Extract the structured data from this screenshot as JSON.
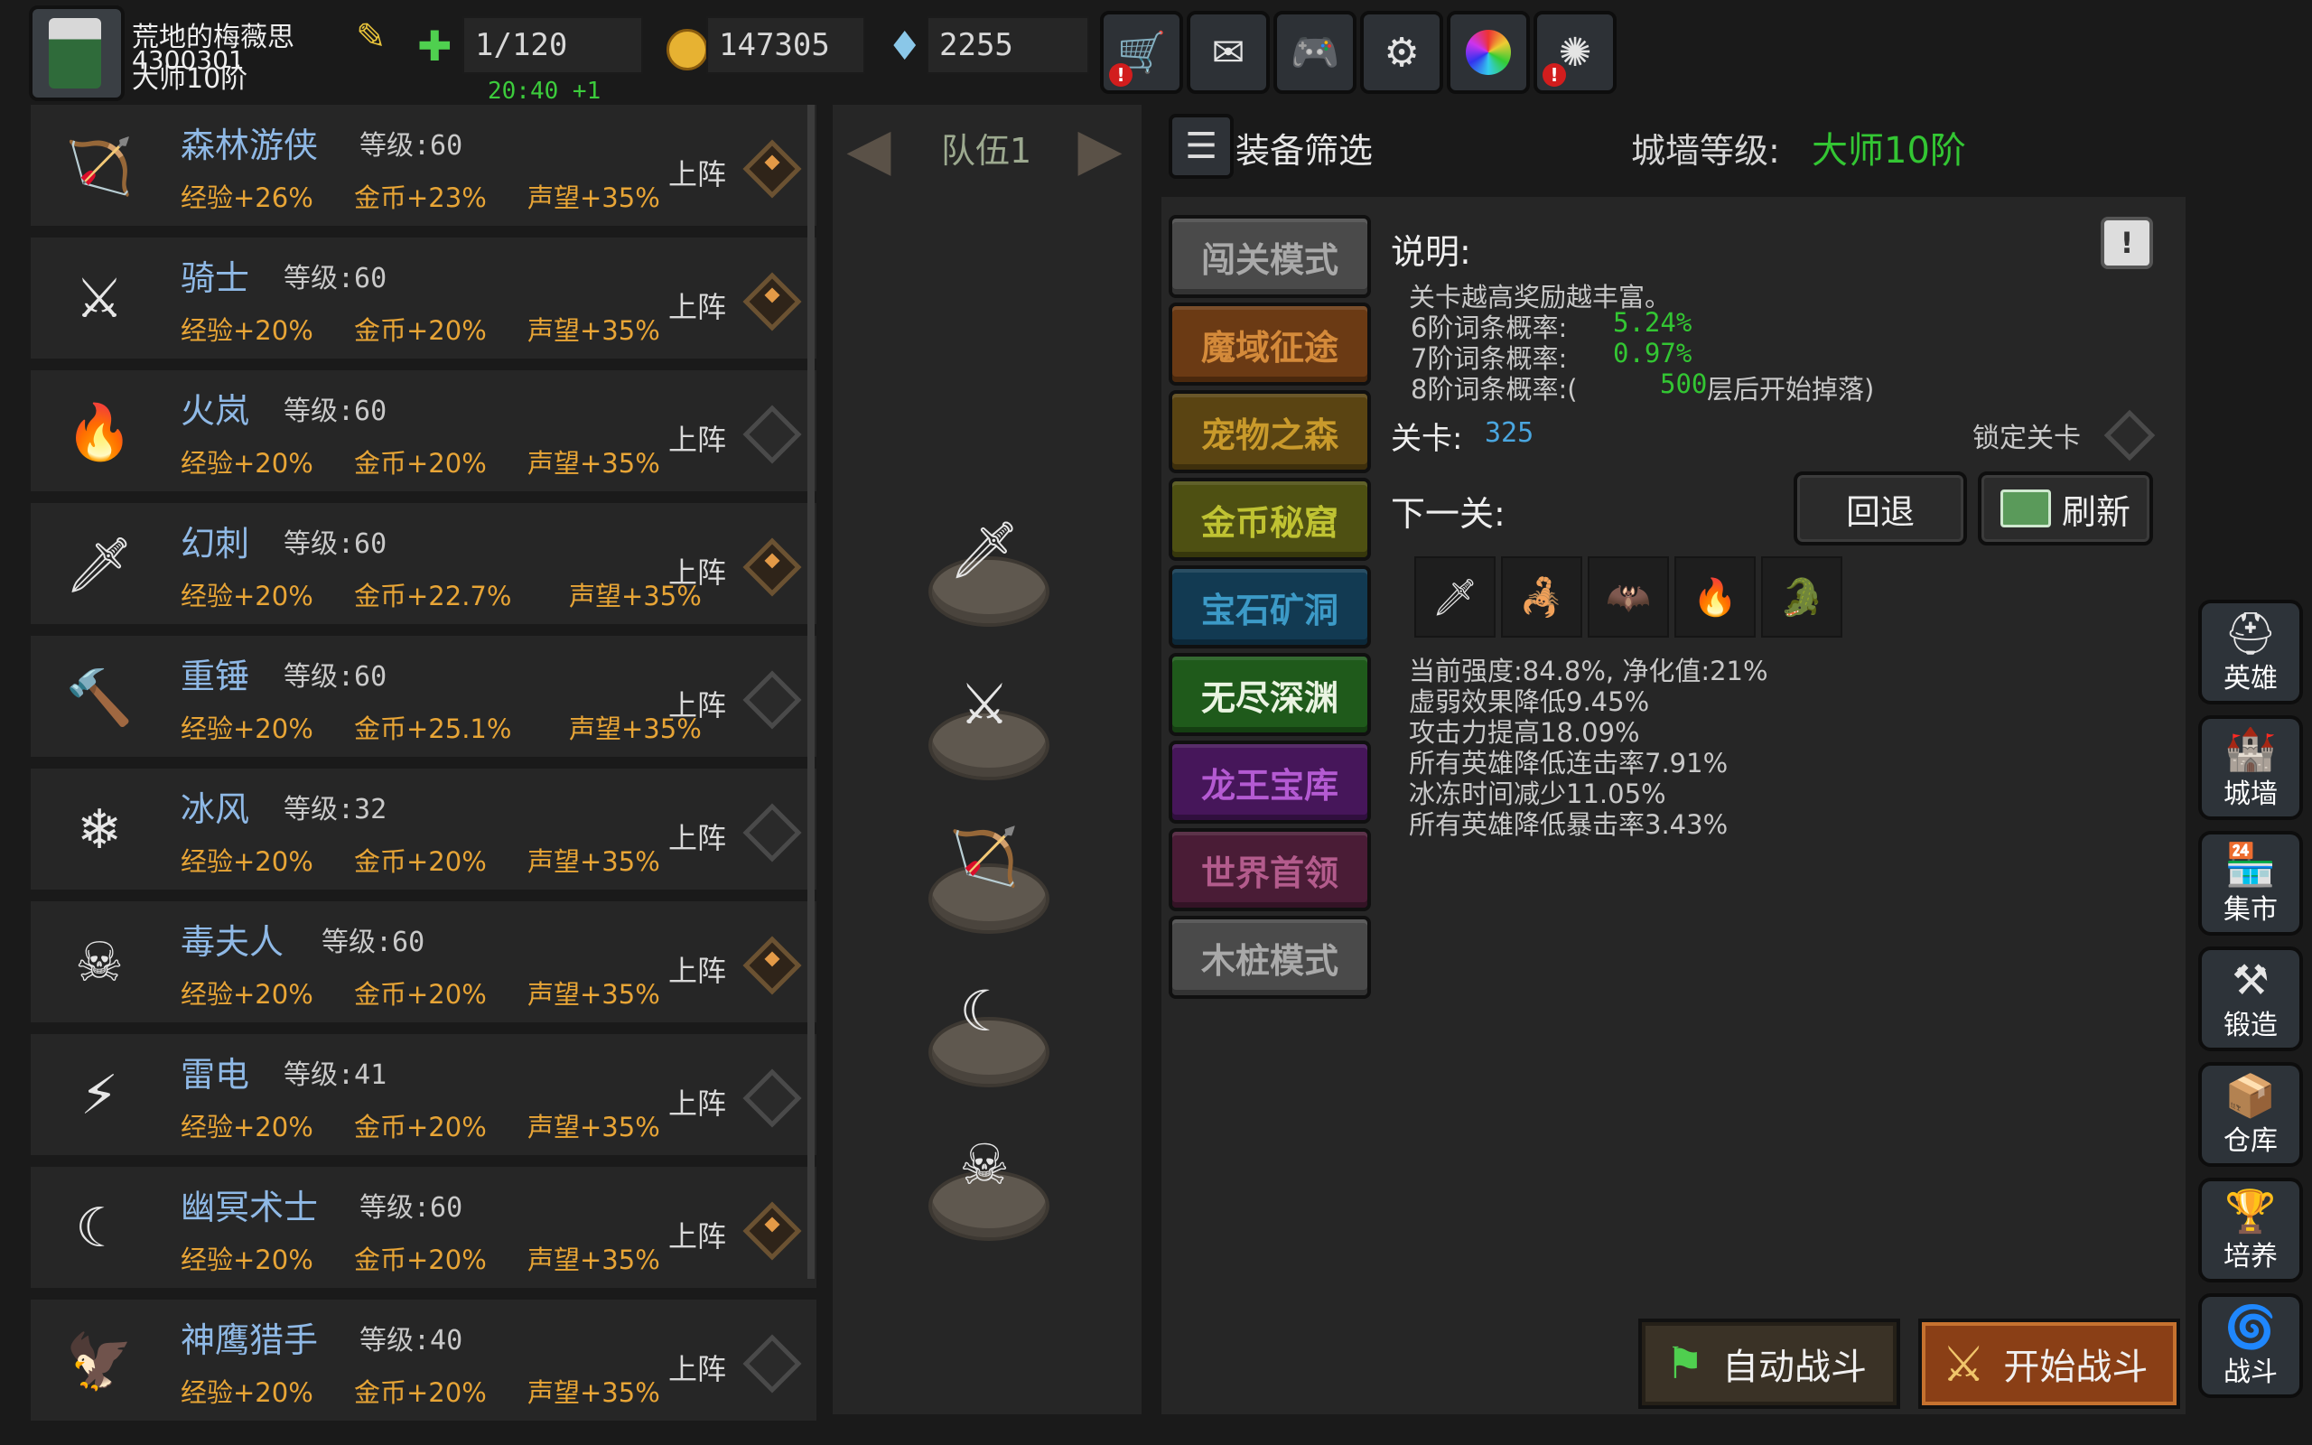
{
  "player": {
    "name": "荒地的梅薇思",
    "id": "4300301",
    "rank": "大师10阶",
    "timer": "20:40 +1"
  },
  "resources": {
    "stamina": "1/120",
    "gold": "147305",
    "gems": "2255"
  },
  "top_icons": [
    "cart-icon",
    "mail-icon",
    "gamepad-icon",
    "gear-icon",
    "color-wheel-icon",
    "fireworks-icon"
  ],
  "heroes": [
    {
      "name": "森林游侠",
      "level": "等级:60",
      "exp": "经验+26%",
      "gold": "金币+23%",
      "fame": "声望+35%",
      "deploy": "上阵",
      "selected": true,
      "glyph": "🏹"
    },
    {
      "name": "骑士",
      "level": "等级:60",
      "exp": "经验+20%",
      "gold": "金币+20%",
      "fame": "声望+35%",
      "deploy": "上阵",
      "selected": true,
      "glyph": "⚔"
    },
    {
      "name": "火岚",
      "level": "等级:60",
      "exp": "经验+20%",
      "gold": "金币+20%",
      "fame": "声望+35%",
      "deploy": "上阵",
      "selected": false,
      "glyph": "🔥"
    },
    {
      "name": "幻刺",
      "level": "等级:60",
      "exp": "经验+20%",
      "gold": "金币+22.7%",
      "fame": "声望+35%",
      "deploy": "上阵",
      "selected": true,
      "glyph": "🗡"
    },
    {
      "name": "重锤",
      "level": "等级:60",
      "exp": "经验+20%",
      "gold": "金币+25.1%",
      "fame": "声望+35%",
      "deploy": "上阵",
      "selected": false,
      "glyph": "🔨"
    },
    {
      "name": "冰风",
      "level": "等级:32",
      "exp": "经验+20%",
      "gold": "金币+20%",
      "fame": "声望+35%",
      "deploy": "上阵",
      "selected": false,
      "glyph": "❄"
    },
    {
      "name": "毒夫人",
      "level": "等级:60",
      "exp": "经验+20%",
      "gold": "金币+20%",
      "fame": "声望+35%",
      "deploy": "上阵",
      "selected": true,
      "glyph": "☠"
    },
    {
      "name": "雷电",
      "level": "等级:41",
      "exp": "经验+20%",
      "gold": "金币+20%",
      "fame": "声望+35%",
      "deploy": "上阵",
      "selected": false,
      "glyph": "⚡"
    },
    {
      "name": "幽冥术士",
      "level": "等级:60",
      "exp": "经验+20%",
      "gold": "金币+20%",
      "fame": "声望+35%",
      "deploy": "上阵",
      "selected": true,
      "glyph": "☾"
    },
    {
      "name": "神鹰猎手",
      "level": "等级:40",
      "exp": "经验+20%",
      "gold": "金币+20%",
      "fame": "声望+35%",
      "deploy": "上阵",
      "selected": false,
      "glyph": "🦅"
    }
  ],
  "team": {
    "label": "队伍1",
    "members": [
      "🗡",
      "⚔",
      "🏹",
      "☾",
      "☠"
    ]
  },
  "header": {
    "filter_label": "装备筛选",
    "wall_level_label": "城墙等级:",
    "wall_level_value": "大师10阶"
  },
  "modes": [
    {
      "label": "闯关模式",
      "bg": "#4a4a4a",
      "fg": "#a9a9a9"
    },
    {
      "label": "魔域征途",
      "bg": "#6b3a14",
      "fg": "#d48a3a"
    },
    {
      "label": "宠物之森",
      "bg": "#5a4412",
      "fg": "#c99a2b"
    },
    {
      "label": "金币秘窟",
      "bg": "#4e5012",
      "fg": "#bfc232"
    },
    {
      "label": "宝石矿洞",
      "bg": "#123a52",
      "fg": "#3c9ac7"
    },
    {
      "label": "无尽深渊",
      "bg": "#1f5a1b",
      "fg": "#eaf4e2"
    },
    {
      "label": "龙王宝库",
      "bg": "#46165a",
      "fg": "#b45ad2"
    },
    {
      "label": "世界首领",
      "bg": "#4a1c36",
      "fg": "#b35b8c"
    },
    {
      "label": "木桩模式",
      "bg": "#4a4a4a",
      "fg": "#a9a9a9"
    }
  ],
  "description": {
    "title": "说明:",
    "line1": "关卡越高奖励越丰富。",
    "t6_label": "6阶词条概率:",
    "t6_value": "5.24%",
    "t7_label": "7阶词条概率:",
    "t7_value": "0.97%",
    "t8_label": "8阶词条概率:(",
    "t8_value": "500",
    "t8_suffix": "层后开始掉落)"
  },
  "stage": {
    "label": "关卡:",
    "value": "325",
    "lock_label": "锁定关卡"
  },
  "next": {
    "label": "下一关:",
    "back_label": "回退",
    "refresh_label": "刷新",
    "enemies": [
      "🗡",
      "🦂",
      "🦇",
      "🔥",
      "🐊"
    ]
  },
  "stats": [
    "当前强度:84.8%, 净化值:21%",
    "虚弱效果降低9.45%",
    "攻击力提高18.09%",
    "所有英雄降低连击率7.91%",
    "冰冻时间减少11.05%",
    "所有英雄降低暴击率3.43%"
  ],
  "side_nav": [
    {
      "label": "英雄",
      "icon": "⛑"
    },
    {
      "label": "城墙",
      "icon": "🏰"
    },
    {
      "label": "集市",
      "icon": "🏪"
    },
    {
      "label": "锻造",
      "icon": "⚒"
    },
    {
      "label": "仓库",
      "icon": "📦"
    },
    {
      "label": "培养",
      "icon": "🏆"
    },
    {
      "label": "战斗",
      "icon": "🌀"
    }
  ],
  "actions": {
    "auto_label": "自动战斗",
    "start_label": "开始战斗"
  },
  "colors": {
    "accent_green": "#33c633",
    "bonus_orange": "#e8a536",
    "name_blue": "#8fb9e6",
    "stage_blue": "#4aa6df"
  }
}
